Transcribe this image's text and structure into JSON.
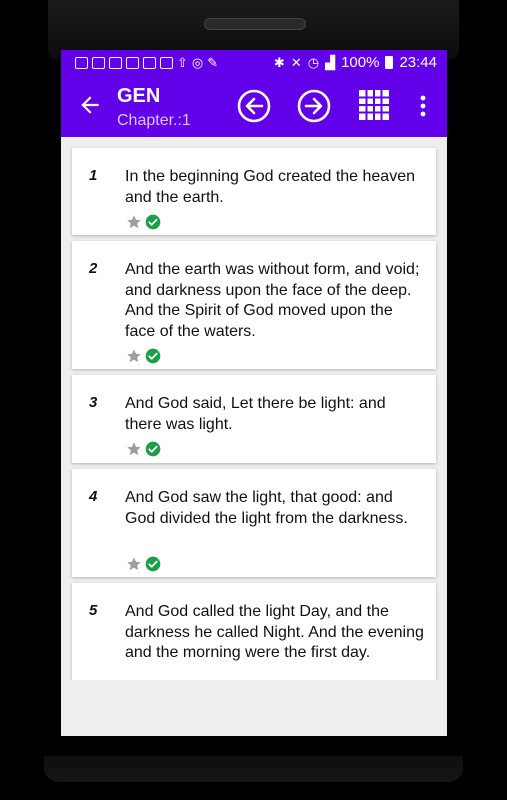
{
  "status_bar": {
    "battery": "100%",
    "time": "23:44"
  },
  "app_bar": {
    "title": "GEN",
    "subtitle": "Chapter.:1"
  },
  "verses": [
    {
      "num": "1",
      "text": "In the beginning God created  the heaven and the earth."
    },
    {
      "num": "2",
      "text": "And the earth was without form, and void; and darkness  upon the face of the deep. And the Spirit of God moved upon the face of the waters."
    },
    {
      "num": "3",
      "text": "And God said, Let there be light: and there was light."
    },
    {
      "num": "4",
      "text": "And God saw  the light, that  good: and God divided  the light from the darkness."
    },
    {
      "num": "5",
      "text": "And God called the light Day, and the darkness he called Night. And the evening and the morning were the first day."
    }
  ],
  "colors": {
    "primary": "#6200ea",
    "check": "#1e9e4a",
    "star": "#9e9e9e"
  }
}
